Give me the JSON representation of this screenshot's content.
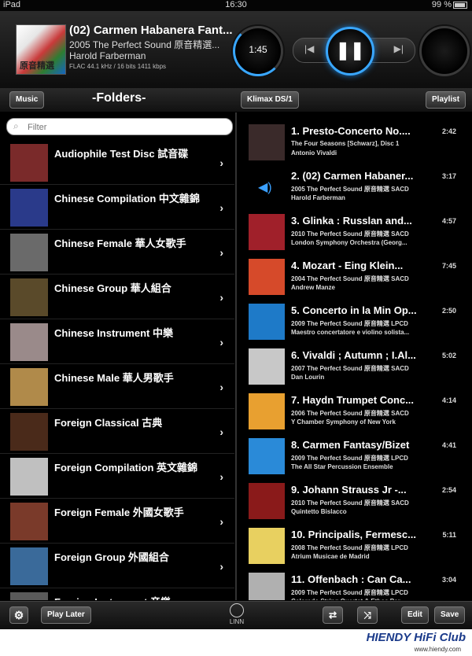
{
  "status": {
    "device": "iPad",
    "time": "16:30",
    "battery": "99 %"
  },
  "now_playing": {
    "title": "(02) Carmen Habanera Fant...",
    "album": "2005 The Perfect Sound 原音精選...",
    "artist": "Harold Farberman",
    "format": "FLAC  44.1 kHz / 16 bits  1411 kbps",
    "elapsed": "1:45",
    "cover_label": "原音精選",
    "pause_glyph": "❚❚",
    "prev_glyph": "|◀",
    "next_glyph": "▶|"
  },
  "toolbar": {
    "music": "Music",
    "folders": "-Folders-",
    "room": "Klimax DS/1",
    "playlist": "Playlist"
  },
  "filter": {
    "placeholder": "Filter",
    "icon": "search-icon"
  },
  "folders": [
    {
      "name": "Audiophile Test Disc 試音碟",
      "color": "#7a2a2a"
    },
    {
      "name": "Chinese Compilation 中文雜錦",
      "color": "#2a3a8a"
    },
    {
      "name": "Chinese Female 華人女歌手",
      "color": "#6a6a6a"
    },
    {
      "name": "Chinese Group 華人組合",
      "color": "#5a4a2a"
    },
    {
      "name": "Chinese Instrument 中樂",
      "color": "#9a8a8a"
    },
    {
      "name": "Chinese Male 華人男歌手",
      "color": "#b08a4a"
    },
    {
      "name": "Foreign Classical 古典",
      "color": "#4a2a1a"
    },
    {
      "name": "Foreign Compilation 英文雜錦",
      "color": "#c0c0c0"
    },
    {
      "name": "Foreign Female 外國女歌手",
      "color": "#7a3a2a"
    },
    {
      "name": "Foreign Group 外國組合",
      "color": "#3a6a9a"
    },
    {
      "name": "Foreign Instrument 音樂",
      "color": "#5a5a5a"
    }
  ],
  "chevron": "›",
  "tracks": [
    {
      "title": "1. Presto-Concerto No....",
      "dur": "2:42",
      "album": "The Four Seasons [Schwarz], Disc 1",
      "artist": "Antonio Vivaldi",
      "color": "#3a2a2a"
    },
    {
      "title": "2. (02) Carmen Habaner...",
      "dur": "3:17",
      "album": "2005 The Perfect Sound 原音精選 SACD",
      "artist": "Harold Farberman",
      "color": "",
      "playing": true
    },
    {
      "title": "3. Glinka : Russlan and...",
      "dur": "4:57",
      "album": "2010 The Perfect Sound 原音精選 SACD",
      "artist": "London Symphony Orchestra (Georg...",
      "color": "#a0202a"
    },
    {
      "title": "4. Mozart - Eing Klein...",
      "dur": "7:45",
      "album": "2004 The Perfect Sound 原音精選 SACD",
      "artist": "Andrew Manze",
      "color": "#d64a2a"
    },
    {
      "title": "5. Concerto in la Min Op...",
      "dur": "2:50",
      "album": "2009 The Perfect Sound 原音精選 LPCD",
      "artist": "Maestro concertatore e violino solista...",
      "color": "#1e7ac8"
    },
    {
      "title": "6. Vivaldi ; Autumn ; I.Al...",
      "dur": "5:02",
      "album": "2007 The Perfect Sound 原音精選 SACD",
      "artist": "Dan Lourin",
      "color": "#c8c8c8"
    },
    {
      "title": "7. Haydn Trumpet Conc...",
      "dur": "4:14",
      "album": "2006 The Perfect Sound 原音精選 SACD",
      "artist": "Y Chamber Symphony of New York",
      "color": "#e8a030"
    },
    {
      "title": "8. Carmen Fantasy/Bizet",
      "dur": "4:41",
      "album": "2009 The Perfect Sound 原音精選 LPCD",
      "artist": "The All Star Percussion Ensemble",
      "color": "#2a8ad8"
    },
    {
      "title": "9. Johann Strauss Jr -...",
      "dur": "2:54",
      "album": "2010 The Perfect Sound 原音精選 SACD",
      "artist": "Quintetto Bislacco",
      "color": "#8a1a1a"
    },
    {
      "title": "10. Principalis, Fermesc...",
      "dur": "5:11",
      "album": "2008 The Perfect Sound 原音精選 LPCD",
      "artist": "Atrium Musicae de Madrid",
      "color": "#e8d060"
    },
    {
      "title": "11. Offenbach : Can Ca...",
      "dur": "3:04",
      "album": "2009 The Perfect Sound 原音精選 LPCD",
      "artist": "Colorado String Quartet & Ethos Per...",
      "color": "#b0b0b0"
    }
  ],
  "speaker_glyph": "◀)",
  "bottom": {
    "gear": "⚙",
    "play_later": "Play Later",
    "brand": "LINN",
    "repeat": "⇄",
    "shuffle": "⤨",
    "edit": "Edit",
    "save": "Save"
  },
  "watermark": {
    "logo": "HIENDY HiFi Club",
    "url": "www.hiendy.com"
  }
}
